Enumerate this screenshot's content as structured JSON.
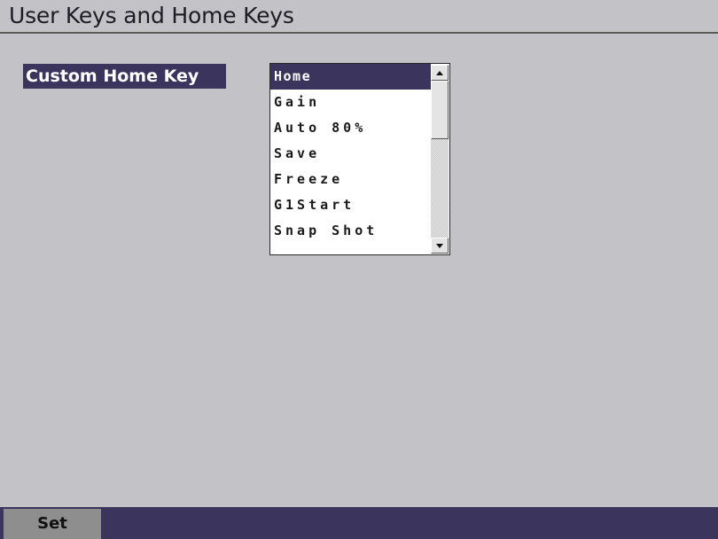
{
  "window": {
    "title": "User Keys and Home Keys"
  },
  "parameter": {
    "label": "Custom Home Key"
  },
  "listbox": {
    "selected_index": 0,
    "items": [
      "Home",
      "Gain",
      "Auto 80%",
      "Save",
      "Freeze",
      "G1Start",
      "Snap Shot"
    ]
  },
  "softkeys": {
    "set_label": "Set"
  },
  "colors": {
    "background": "#c3c3c7",
    "accent": "#3b355e",
    "softkey": "#8e8e8e"
  },
  "icons": {
    "scroll_up": "scroll-up-arrow-icon",
    "scroll_down": "scroll-down-arrow-icon"
  }
}
